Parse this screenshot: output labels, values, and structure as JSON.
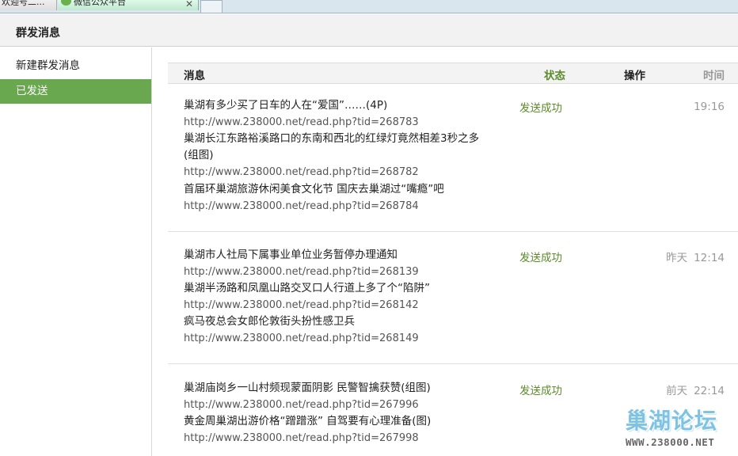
{
  "tabs": [
    {
      "label": "欢迎号二..."
    },
    {
      "label": "微信公众平台"
    }
  ],
  "header": {
    "title": "群发消息"
  },
  "sidebar": {
    "items": [
      {
        "label": "新建群发消息"
      },
      {
        "label": "已发送"
      }
    ]
  },
  "table": {
    "headers": {
      "message": "消息",
      "status": "状态",
      "action": "操作",
      "time": "时间"
    },
    "groups": [
      {
        "status": "发送成功",
        "day": "",
        "time": "19:16",
        "items": [
          {
            "title": "巢湖有多少买了日车的人在“爱国”……(4P)",
            "url": "http://www.238000.net/read.php?tid=268783"
          },
          {
            "title": "巢湖长江东路裕溪路口的东南和西北的红绿灯竟然相差3秒之多(组图)",
            "url": "http://www.238000.net/read.php?tid=268782"
          },
          {
            "title": "首届环巢湖旅游休闲美食文化节 国庆去巢湖过“嘴瘾”吧",
            "url": "http://www.238000.net/read.php?tid=268784"
          }
        ]
      },
      {
        "status": "发送成功",
        "day": "昨天",
        "time": "12:14",
        "items": [
          {
            "title": "巢湖市人社局下属事业单位业务暂停办理通知",
            "url": "http://www.238000.net/read.php?tid=268139"
          },
          {
            "title": "巢湖半汤路和凤凰山路交叉口人行道上多了个“陷阱”",
            "url": "http://www.238000.net/read.php?tid=268142"
          },
          {
            "title": "疯马夜总会女郎伦敦街头扮性感卫兵",
            "url": "http://www.238000.net/read.php?tid=268149"
          }
        ]
      },
      {
        "status": "发送成功",
        "day": "前天",
        "time": "22:14",
        "items": [
          {
            "title": "巢湖庙岗乡一山村频现蒙面阴影 民警智擒获赞(组图)",
            "url": "http://www.238000.net/read.php?tid=267996"
          },
          {
            "title": "黄金周巢湖出游价格“蹭蹭涨” 自驾要有心理准备(图)",
            "url": "http://www.238000.net/read.php?tid=267998"
          }
        ]
      }
    ]
  },
  "watermark": {
    "logo": "巢湖论坛",
    "url": "WWW.238000.NET"
  }
}
